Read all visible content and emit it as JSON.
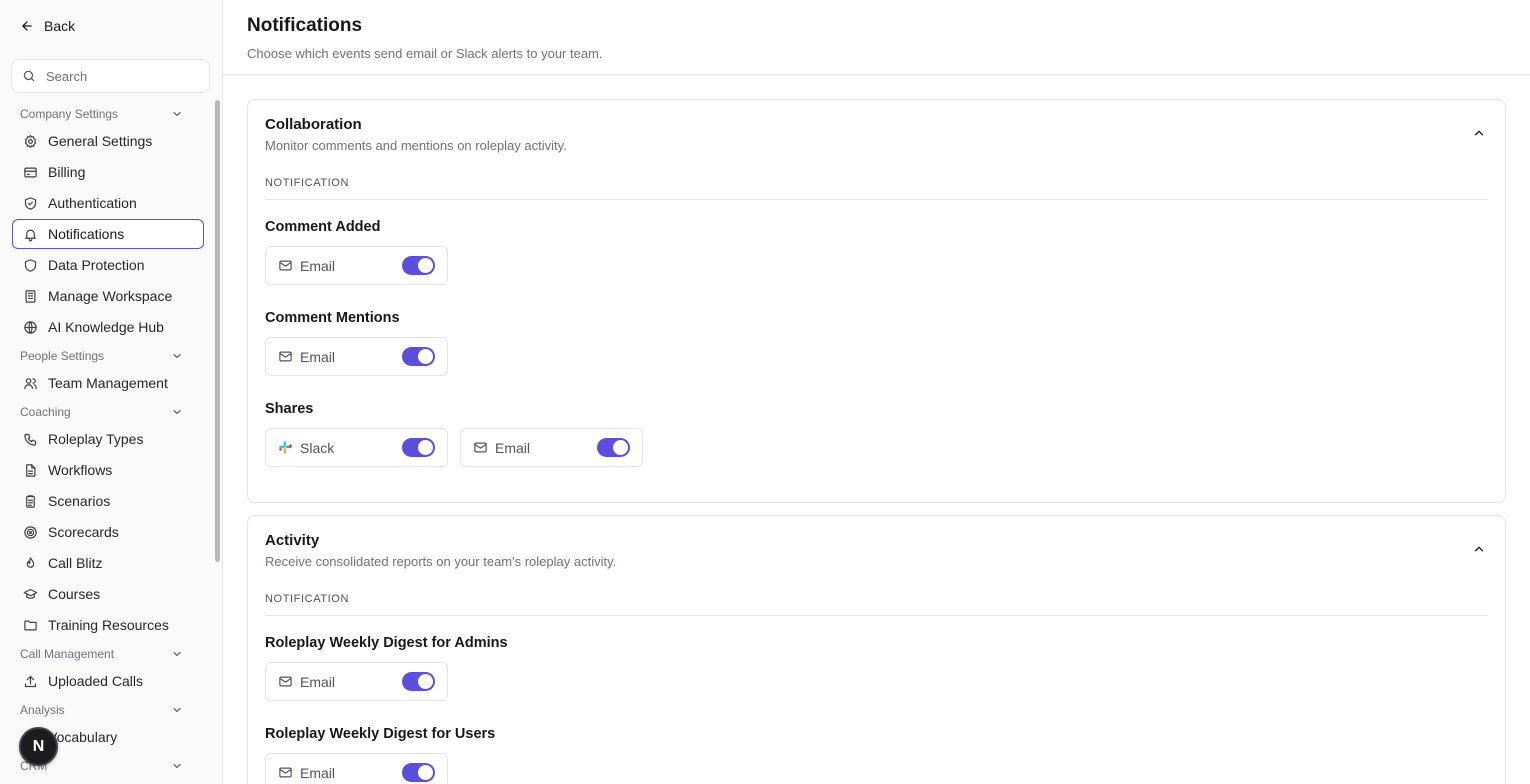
{
  "back_label": "Back",
  "search": {
    "placeholder": "Search"
  },
  "sidebar": [
    {
      "type": "group",
      "label": "Company Settings"
    },
    {
      "type": "item",
      "label": "General Settings",
      "icon": "gear-icon"
    },
    {
      "type": "item",
      "label": "Billing",
      "icon": "credit-card-icon"
    },
    {
      "type": "item",
      "label": "Authentication",
      "icon": "shield-icon"
    },
    {
      "type": "item",
      "label": "Notifications",
      "icon": "bell-icon",
      "active": true
    },
    {
      "type": "item",
      "label": "Data Protection",
      "icon": "database-shield-icon"
    },
    {
      "type": "item",
      "label": "Manage Workspace",
      "icon": "building-icon"
    },
    {
      "type": "item",
      "label": "AI Knowledge Hub",
      "icon": "globe-icon"
    },
    {
      "type": "group",
      "label": "People Settings"
    },
    {
      "type": "item",
      "label": "Team Management",
      "icon": "users-icon"
    },
    {
      "type": "group",
      "label": "Coaching"
    },
    {
      "type": "item",
      "label": "Roleplay Types",
      "icon": "phone-icon"
    },
    {
      "type": "item",
      "label": "Workflows",
      "icon": "file-icon"
    },
    {
      "type": "item",
      "label": "Scenarios",
      "icon": "clipboard-icon"
    },
    {
      "type": "item",
      "label": "Scorecards",
      "icon": "target-icon"
    },
    {
      "type": "item",
      "label": "Call Blitz",
      "icon": "flame-icon"
    },
    {
      "type": "item",
      "label": "Courses",
      "icon": "graduation-cap-icon"
    },
    {
      "type": "item",
      "label": "Training Resources",
      "icon": "folder-icon"
    },
    {
      "type": "group",
      "label": "Call Management"
    },
    {
      "type": "item",
      "label": "Uploaded Calls",
      "icon": "upload-icon"
    },
    {
      "type": "group",
      "label": "Analysis"
    },
    {
      "type": "item",
      "label": "Vocabulary",
      "icon": "book-icon"
    },
    {
      "type": "group",
      "label": "CRM"
    }
  ],
  "avatar_initial": "N",
  "header": {
    "title": "Notifications",
    "subtitle": "Choose which events send email or Slack alerts to your team."
  },
  "cards": [
    {
      "title": "Collaboration",
      "desc": "Monitor comments and mentions on roleplay activity.",
      "column_header": "NOTIFICATION",
      "rows": [
        {
          "label": "Comment Added",
          "channels": [
            {
              "name": "Email",
              "icon": "mail-icon",
              "enabled": true
            }
          ]
        },
        {
          "label": "Comment Mentions",
          "channels": [
            {
              "name": "Email",
              "icon": "mail-icon",
              "enabled": true
            }
          ]
        },
        {
          "label": "Shares",
          "channels": [
            {
              "name": "Slack",
              "icon": "slack-icon",
              "enabled": true
            },
            {
              "name": "Email",
              "icon": "mail-icon",
              "enabled": true
            }
          ]
        }
      ]
    },
    {
      "title": "Activity",
      "desc": "Receive consolidated reports on your team's roleplay activity.",
      "column_header": "NOTIFICATION",
      "rows": [
        {
          "label": "Roleplay Weekly Digest for Admins",
          "channels": [
            {
              "name": "Email",
              "icon": "mail-icon",
              "enabled": true
            }
          ]
        },
        {
          "label": "Roleplay Weekly Digest for Users",
          "channels": [
            {
              "name": "Email",
              "icon": "mail-icon",
              "enabled": true
            }
          ]
        }
      ]
    }
  ],
  "colors": {
    "accent": "#5b4fe0",
    "muted_text": "#71717a",
    "border": "#e4e4e7"
  }
}
